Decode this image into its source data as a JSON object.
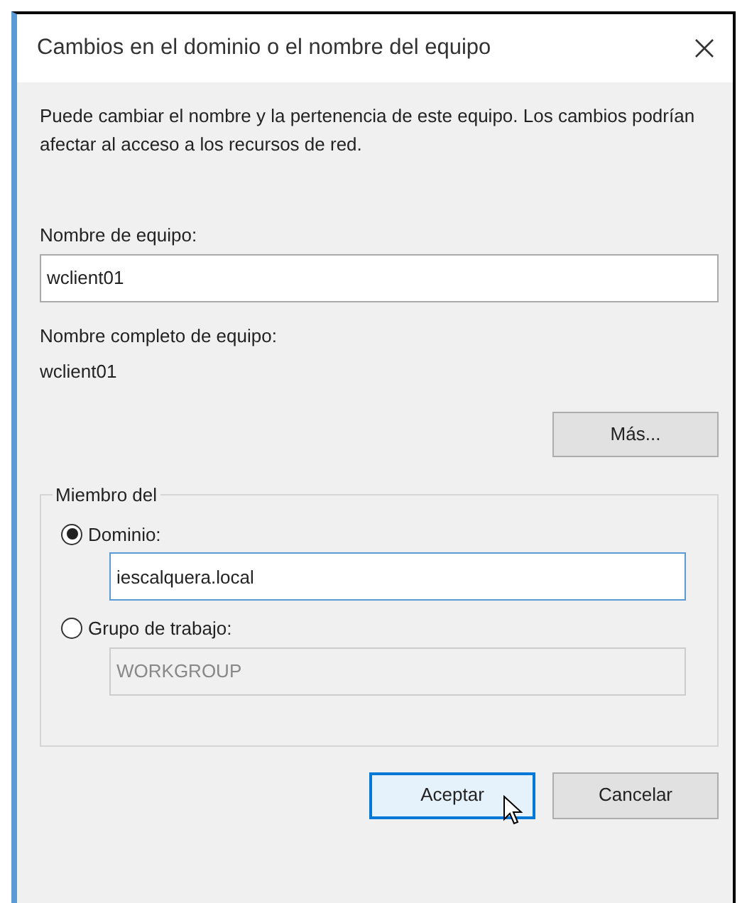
{
  "window": {
    "title": "Cambios en el dominio o el nombre del equipo"
  },
  "description": "Puede cambiar el nombre y la pertenencia de este equipo. Los cambios podrían afectar al acceso a los recursos de red.",
  "computer_name": {
    "label": "Nombre de equipo:",
    "value": "wclient01"
  },
  "full_name": {
    "label": "Nombre completo de equipo:",
    "value": "wclient01"
  },
  "more_button": "Más...",
  "member_of": {
    "legend": "Miembro del",
    "options": [
      {
        "label": "Dominio:",
        "selected": true,
        "value": "iescalquera.local",
        "disabled": false
      },
      {
        "label": "Grupo de trabajo:",
        "selected": false,
        "value": "WORKGROUP",
        "disabled": true
      }
    ]
  },
  "buttons": [
    {
      "label": "Aceptar",
      "focused": true
    },
    {
      "label": "Cancelar",
      "focused": false
    }
  ]
}
